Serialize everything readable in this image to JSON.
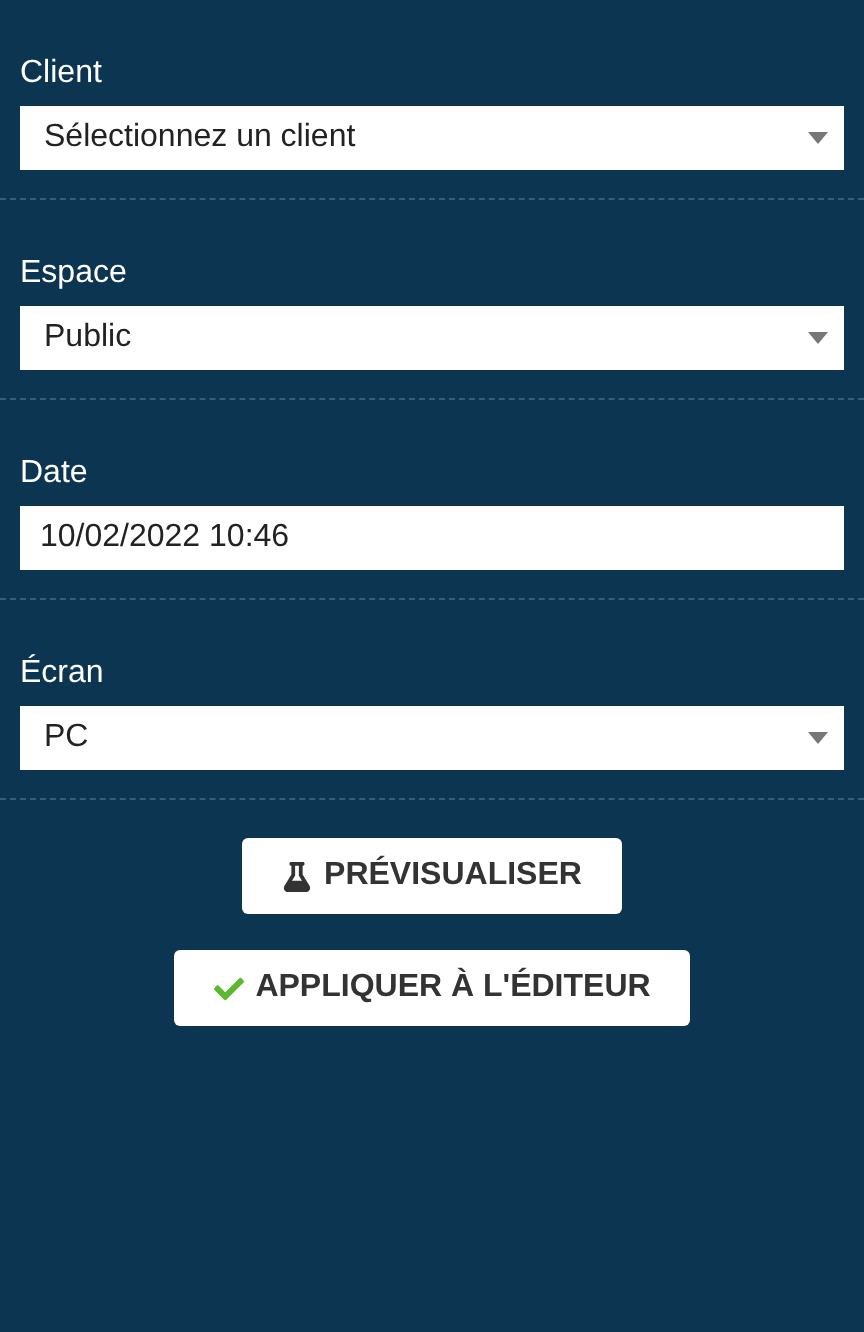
{
  "fields": [
    {
      "label": "Client",
      "kind": "select",
      "value": "Sélectionnez un client"
    },
    {
      "label": "Espace",
      "kind": "select",
      "value": "Public"
    },
    {
      "label": "Date",
      "kind": "input",
      "value": "10/02/2022 10:46"
    },
    {
      "label": "Écran",
      "kind": "select",
      "value": "PC"
    }
  ],
  "buttons": [
    {
      "label": "PRÉVISUALISER",
      "kind": "preview"
    },
    {
      "label": "APPLIQUER À L'ÉDITEUR",
      "kind": "apply"
    }
  ]
}
